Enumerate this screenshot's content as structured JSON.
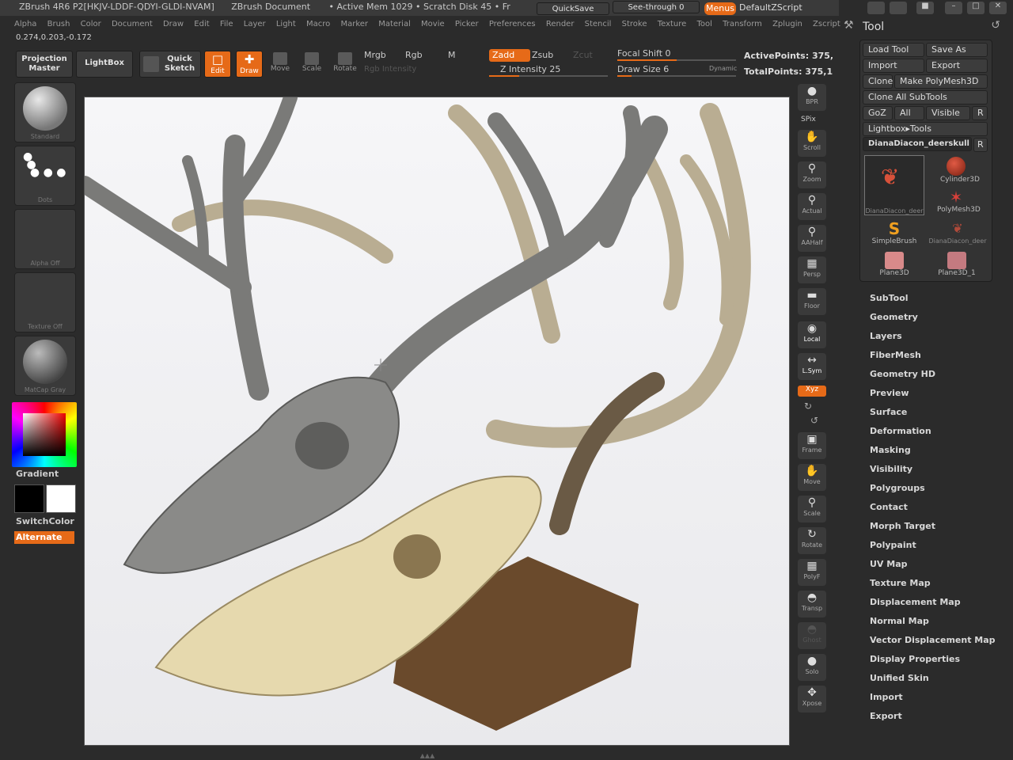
{
  "titlebar": {
    "app": "ZBrush 4R6 P2[HKJV-LDDF-QDYI-GLDI-NVAM]",
    "doc": "ZBrush Document",
    "mem": "• Active Mem 1029 • Scratch Disk 45 • Fr",
    "quicksave": "QuickSave",
    "seethrough": "See-through  0",
    "menus": "Menus",
    "script": "DefaultZScript"
  },
  "menubar": [
    "Alpha",
    "Brush",
    "Color",
    "Document",
    "Draw",
    "Edit",
    "File",
    "Layer",
    "Light",
    "Macro",
    "Marker",
    "Material",
    "Movie",
    "Picker",
    "Preferences",
    "Render",
    "Stencil",
    "Stroke",
    "Texture",
    "Tool",
    "Transform",
    "Zplugin",
    "Zscript"
  ],
  "coords": "0.274,0.203,-0.172",
  "toolbar": {
    "projection": "Projection Master",
    "lightbox": "LightBox",
    "quicksketch": "Quick Sketch",
    "edit": "Edit",
    "draw": "Draw",
    "move": "Move",
    "scale": "Scale",
    "rotate": "Rotate",
    "mrgb": "Mrgb",
    "rgb": "Rgb",
    "m": "M",
    "rgb_intensity": "Rgb Intensity",
    "zadd": "Zadd",
    "zsub": "Zsub",
    "zcut": "Zcut",
    "z_intensity": "Z Intensity 25",
    "focal_shift": "Focal Shift 0",
    "draw_size": "Draw Size 6",
    "dynamic": "Dynamic",
    "active_points": "ActivePoints: 375,",
    "total_points": "TotalPoints: 375,1"
  },
  "left": {
    "brush": "Standard",
    "stroke": "Dots",
    "alpha": "Alpha  Off",
    "texture": "Texture  Off",
    "material": "MatCap Gray",
    "gradient": "Gradient",
    "switch": "SwitchColor",
    "alternate": "Alternate"
  },
  "right_shelf": [
    "BPR",
    "SPix",
    "Scroll",
    "Zoom",
    "Actual",
    "AAHalf",
    "Persp",
    "Floor",
    "Local",
    "L.Sym",
    "Xyz",
    "Frame",
    "Move",
    "Scale",
    "Rotate",
    "PolyF",
    "Transp",
    "Ghost",
    "Solo",
    "Xpose"
  ],
  "tool_panel": {
    "title": "Tool",
    "load": "Load Tool",
    "save": "Save As",
    "import": "Import",
    "export": "Export",
    "clone": "Clone",
    "polymesh": "Make PolyMesh3D",
    "clone_all": "Clone  All  SubTools",
    "goz": "GoZ",
    "all": "All",
    "visible": "Visible",
    "r": "R",
    "lightbox_tools": "Lightbox▸Tools",
    "current": "DianaDiacon_deerskull",
    "thumbs": [
      "DianaDiacon_deer",
      "Cylinder3D",
      "PolyMesh3D",
      "SimpleBrush",
      "DianaDiacon_deer",
      "Plane3D",
      "Plane3D_1"
    ],
    "sections": [
      "SubTool",
      "Geometry",
      "Layers",
      "FiberMesh",
      "Geometry HD",
      "Preview",
      "Surface",
      "Deformation",
      "Masking",
      "Visibility",
      "Polygroups",
      "Contact",
      "Morph Target",
      "Polypaint",
      "UV Map",
      "Texture Map",
      "Displacement Map",
      "Normal Map",
      "Vector Displacement Map",
      "Display Properties",
      "Unified Skin",
      "Import",
      "Export"
    ]
  },
  "colors": {
    "accent": "#e66a18",
    "bg": "#2b2b2b",
    "canvas": "#f2f2f4"
  }
}
